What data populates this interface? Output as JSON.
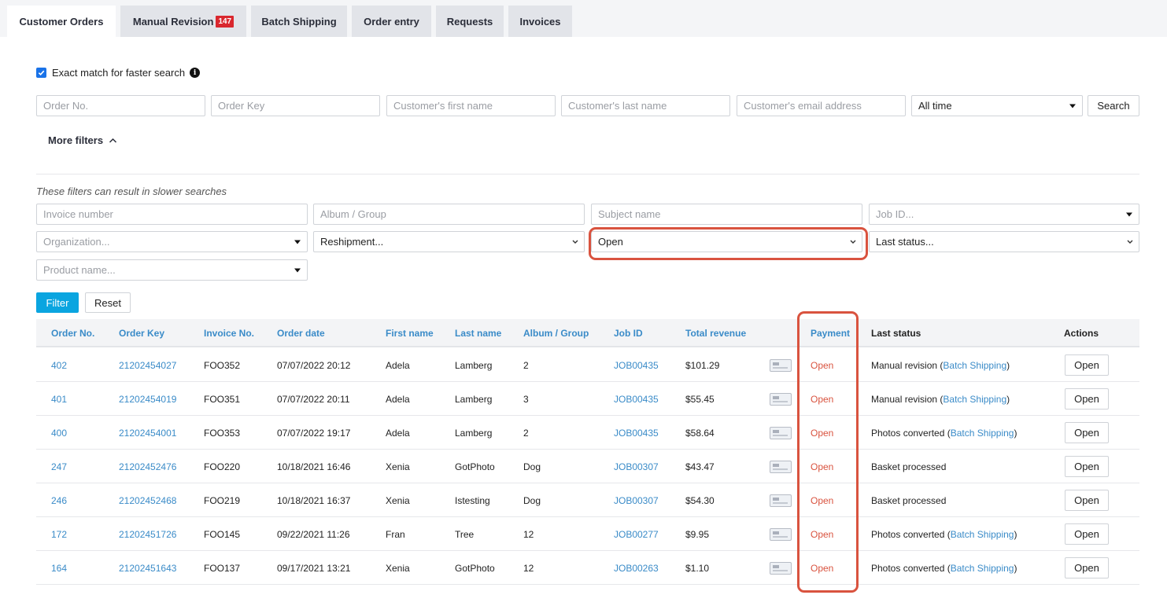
{
  "tabs": [
    {
      "label": "Customer Orders",
      "active": true
    },
    {
      "label": "Manual Revision",
      "badge": "147"
    },
    {
      "label": "Batch Shipping"
    },
    {
      "label": "Order entry"
    },
    {
      "label": "Requests"
    },
    {
      "label": "Invoices"
    }
  ],
  "search": {
    "exact_match_label": "Exact match for faster search",
    "exact_match_checked": true,
    "order_no_placeholder": "Order No.",
    "order_key_placeholder": "Order Key",
    "first_name_placeholder": "Customer's first name",
    "last_name_placeholder": "Customer's last name",
    "email_placeholder": "Customer's email address",
    "time_range": "All time",
    "search_label": "Search",
    "more_filters_label": "More filters"
  },
  "filters": {
    "note": "These filters can result in slower searches",
    "invoice_placeholder": "Invoice number",
    "album_placeholder": "Album / Group",
    "subject_placeholder": "Subject name",
    "job_id_placeholder": "Job ID...",
    "organization_placeholder": "Organization...",
    "reshipment_placeholder": "Reshipment...",
    "payment_value": "Open",
    "last_status_placeholder": "Last status...",
    "product_placeholder": "Product name...",
    "filter_label": "Filter",
    "reset_label": "Reset"
  },
  "table": {
    "headers": {
      "order_no": "Order No.",
      "order_key": "Order Key",
      "invoice_no": "Invoice No.",
      "order_date": "Order date",
      "first_name": "First name",
      "last_name": "Last name",
      "album": "Album / Group",
      "job_id": "Job ID",
      "revenue": "Total revenue",
      "payment": "Payment",
      "last_status": "Last status",
      "actions": "Actions"
    },
    "rows": [
      {
        "order_no": "402",
        "order_key": "21202454027",
        "invoice_no": "FOO352",
        "order_date": "07/07/2022 20:12",
        "first_name": "Adela",
        "last_name": "Lamberg",
        "album": "2",
        "job_id": "JOB00435",
        "revenue": "$101.29",
        "payment": "Open",
        "status": "Manual revision",
        "status_link": "Batch Shipping",
        "action": "Open"
      },
      {
        "order_no": "401",
        "order_key": "21202454019",
        "invoice_no": "FOO351",
        "order_date": "07/07/2022 20:11",
        "first_name": "Adela",
        "last_name": "Lamberg",
        "album": "3",
        "job_id": "JOB00435",
        "revenue": "$55.45",
        "payment": "Open",
        "status": "Manual revision",
        "status_link": "Batch Shipping",
        "action": "Open"
      },
      {
        "order_no": "400",
        "order_key": "21202454001",
        "invoice_no": "FOO353",
        "order_date": "07/07/2022 19:17",
        "first_name": "Adela",
        "last_name": "Lamberg",
        "album": "2",
        "job_id": "JOB00435",
        "revenue": "$58.64",
        "payment": "Open",
        "status": "Photos converted",
        "status_link": "Batch Shipping",
        "action": "Open"
      },
      {
        "order_no": "247",
        "order_key": "21202452476",
        "invoice_no": "FOO220",
        "order_date": "10/18/2021 16:46",
        "first_name": "Xenia",
        "last_name": "GotPhoto",
        "album": "Dog",
        "job_id": "JOB00307",
        "revenue": "$43.47",
        "payment": "Open",
        "status": "Basket processed",
        "status_link": "",
        "action": "Open"
      },
      {
        "order_no": "246",
        "order_key": "21202452468",
        "invoice_no": "FOO219",
        "order_date": "10/18/2021 16:37",
        "first_name": "Xenia",
        "last_name": "Istesting",
        "album": "Dog",
        "job_id": "JOB00307",
        "revenue": "$54.30",
        "payment": "Open",
        "status": "Basket processed",
        "status_link": "",
        "action": "Open"
      },
      {
        "order_no": "172",
        "order_key": "21202451726",
        "invoice_no": "FOO145",
        "order_date": "09/22/2021 11:26",
        "first_name": "Fran",
        "last_name": "Tree",
        "album": "12",
        "job_id": "JOB00277",
        "revenue": "$9.95",
        "payment": "Open",
        "status": "Photos converted",
        "status_link": "Batch Shipping",
        "action": "Open"
      },
      {
        "order_no": "164",
        "order_key": "21202451643",
        "invoice_no": "FOO137",
        "order_date": "09/17/2021 13:21",
        "first_name": "Xenia",
        "last_name": "GotPhoto",
        "album": "12",
        "job_id": "JOB00263",
        "revenue": "$1.10",
        "payment": "Open",
        "status": "Photos converted",
        "status_link": "Batch Shipping",
        "action": "Open"
      }
    ]
  },
  "colors": {
    "accent": "#3a8bc8",
    "filter_button": "#0aa5e0",
    "open_status": "#d9533f",
    "highlight": "#d9533f",
    "badge": "#d9272e"
  }
}
